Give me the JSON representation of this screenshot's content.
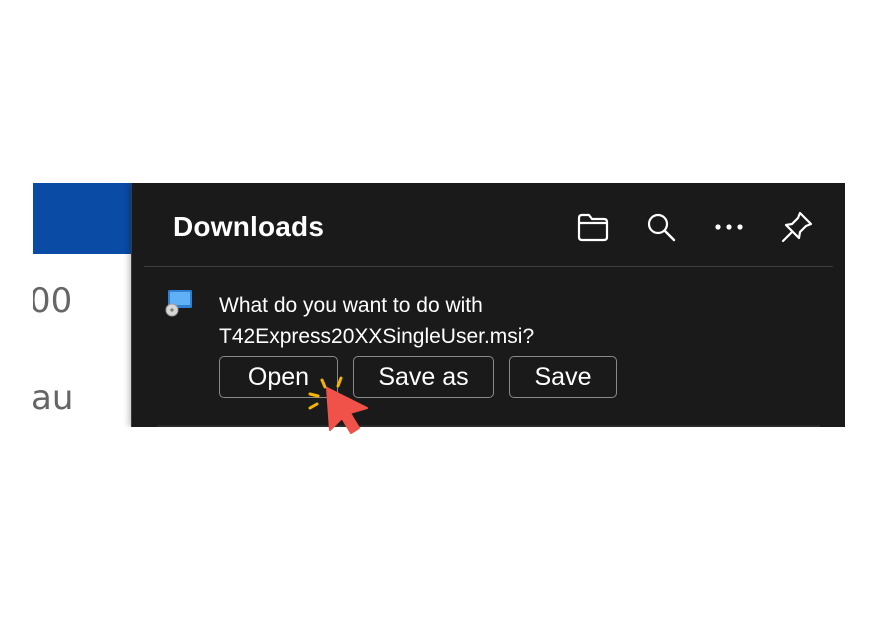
{
  "background_page": {
    "fragment_1": "00",
    "fragment_2": "au",
    "banner_color": "#0a4ba6"
  },
  "downloads_panel": {
    "title": "Downloads",
    "header_icons": [
      "folder-icon",
      "search-icon",
      "more-options-icon",
      "pin-icon"
    ],
    "prompt_line_1": "What do you want to do with",
    "prompt_line_2": "T42Express20XXSingleUser.msi?",
    "file_icon": "installer-file-icon",
    "buttons": {
      "open": "Open",
      "save_as": "Save as",
      "save": "Save"
    },
    "background_color": "#1a1a1a"
  },
  "annotation": {
    "cursor_icon": "click-cursor-icon",
    "cursor_color": "#f0524a",
    "spark_color": "#f5b400"
  }
}
